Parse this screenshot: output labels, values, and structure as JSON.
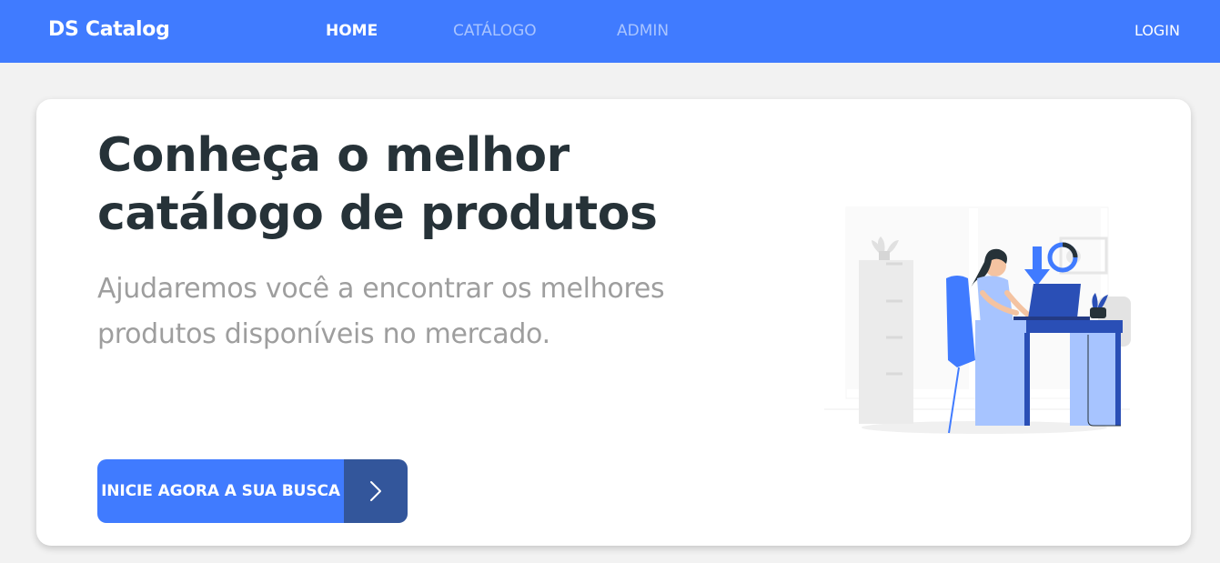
{
  "navbar": {
    "brand": "DS Catalog",
    "links": [
      {
        "label": "HOME",
        "active": true
      },
      {
        "label": "CATÁLOGO",
        "active": false
      },
      {
        "label": "ADMIN",
        "active": false
      }
    ],
    "login": "LOGIN"
  },
  "hero": {
    "title_line1": "Conheça o melhor",
    "title_line2": "catálogo de produtos",
    "subtitle_line1": "Ajudaremos você a encontrar os melhores",
    "subtitle_line2": "produtos disponíveis no mercado.",
    "cta_label": "INICIE AGORA A SUA BUSCA",
    "cta_icon": "chevron-right-icon",
    "illustration": "woman-working-at-desk-illustration"
  },
  "colors": {
    "primary": "#407bff",
    "primary_dark": "#33569b",
    "heading": "#263238",
    "muted": "#9e9e9e"
  }
}
